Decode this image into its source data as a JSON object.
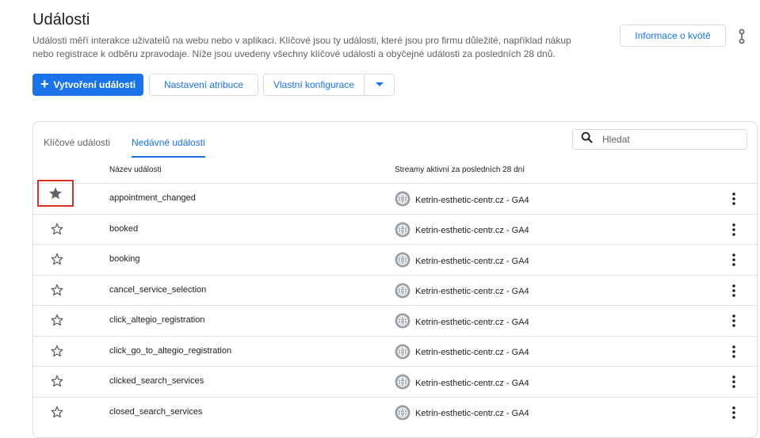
{
  "header": {
    "title": "Události",
    "description": "Události měří interakce uživatelů na webu nebo v aplikaci. Klíčové jsou ty události, které jsou pro firmu důležité, například nákup nebo registrace k odběru zpravodaje. Níže jsou uvedeny všechny klíčové události a obyčejné události za posledních 28 dnů.",
    "info_button": "Informace o kvótě"
  },
  "toolbar": {
    "create_label": "Vytvoření události",
    "attribution_label": "Nastavení atribuce",
    "custom_config_label": "Vlastní konfigurace"
  },
  "tabs": [
    {
      "label": "Klíčové události",
      "active": false
    },
    {
      "label": "Nedávné události",
      "active": true
    }
  ],
  "search": {
    "placeholder": "Hledat"
  },
  "table": {
    "columns": {
      "name": "Název události",
      "streams": "Streamy aktivní za posledních 28 dní"
    },
    "rows": [
      {
        "name": "appointment_changed",
        "stream": "Ketrin-esthetic-centr.cz - GA4",
        "key_event": true
      },
      {
        "name": "booked",
        "stream": "Ketrin-esthetic-centr.cz - GA4",
        "key_event": false
      },
      {
        "name": "booking",
        "stream": "Ketrin-esthetic-centr.cz - GA4",
        "key_event": false
      },
      {
        "name": "cancel_service_selection",
        "stream": "Ketrin-esthetic-centr.cz - GA4",
        "key_event": false
      },
      {
        "name": "click_altegio_registration",
        "stream": "Ketrin-esthetic-centr.cz - GA4",
        "key_event": false
      },
      {
        "name": "click_go_to_altegio_registration",
        "stream": "Ketrin-esthetic-centr.cz - GA4",
        "key_event": false
      },
      {
        "name": "clicked_search_services",
        "stream": "Ketrin-esthetic-centr.cz - GA4",
        "key_event": false
      },
      {
        "name": "closed_search_services",
        "stream": "Ketrin-esthetic-centr.cz - GA4",
        "key_event": false
      }
    ]
  },
  "colors": {
    "accent": "#1a73e8",
    "highlight": "#d93025",
    "star": "#5f6368"
  },
  "icons": {
    "add": "plus-icon",
    "search": "search-icon",
    "stream": "globe-icon",
    "menu": "more-vert-icon",
    "key_event": "star-icon",
    "dropdown": "caret-down-icon"
  }
}
